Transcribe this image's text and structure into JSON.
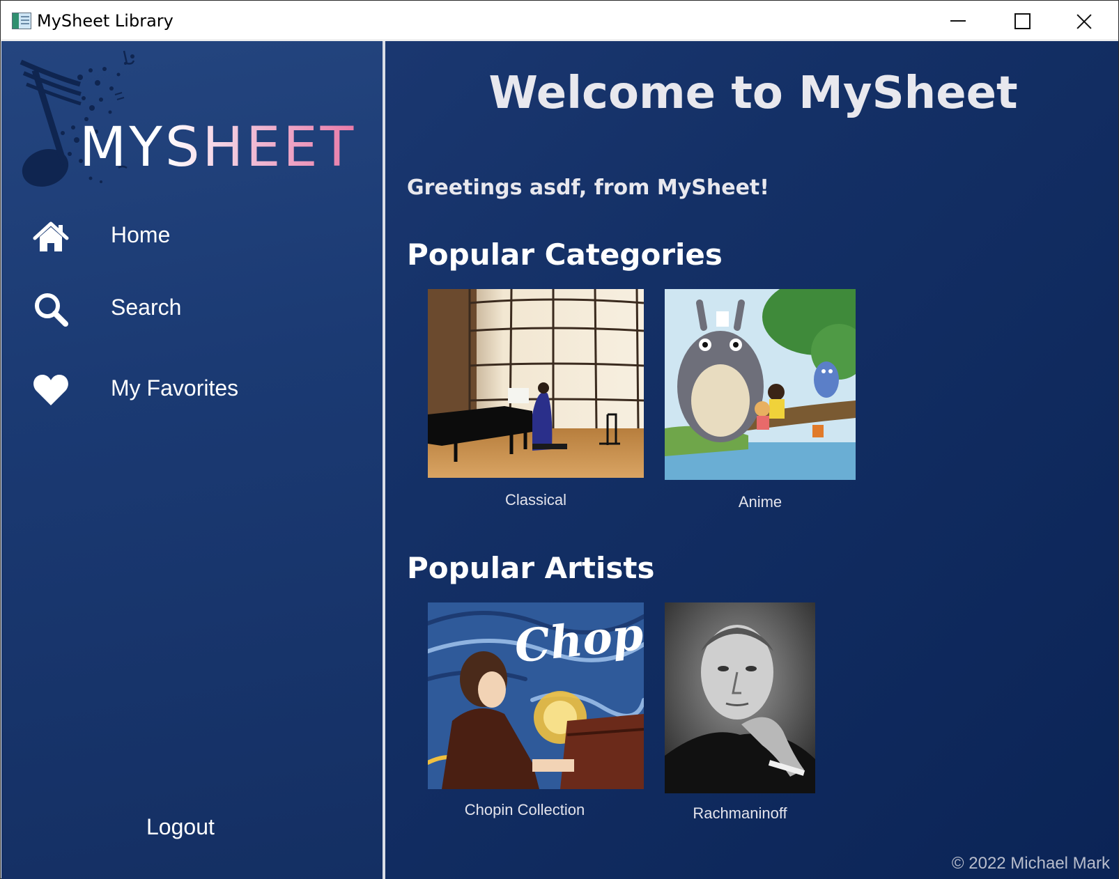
{
  "window": {
    "title": "MySheet Library"
  },
  "sidebar": {
    "logo_text": "MYSHEET",
    "items": [
      {
        "label": "Home",
        "icon": "home-icon"
      },
      {
        "label": "Search",
        "icon": "search-icon"
      },
      {
        "label": "My Favorites",
        "icon": "heart-icon"
      }
    ],
    "logout_label": "Logout"
  },
  "main": {
    "welcome": "Welcome to MySheet",
    "greeting": "Greetings asdf, from MySheet!",
    "categories_heading": "Popular Categories",
    "categories": [
      {
        "label": "Classical",
        "image": "concert-pianist-photo"
      },
      {
        "label": "Anime",
        "image": "anime-totoro-illustration"
      }
    ],
    "artists_heading": "Popular Artists",
    "artists": [
      {
        "label": "Chopin Collection",
        "image": "chopin-painting",
        "image_text": "Chopin"
      },
      {
        "label": "Rachmaninoff",
        "image": "rachmaninoff-portrait"
      }
    ],
    "copyright": "© 2022 Michael Mark"
  },
  "colors": {
    "background_top": "#1f3d78",
    "background_bottom": "#0b2456",
    "text": "#ffffff",
    "logo_accent": "#e97aa8"
  }
}
